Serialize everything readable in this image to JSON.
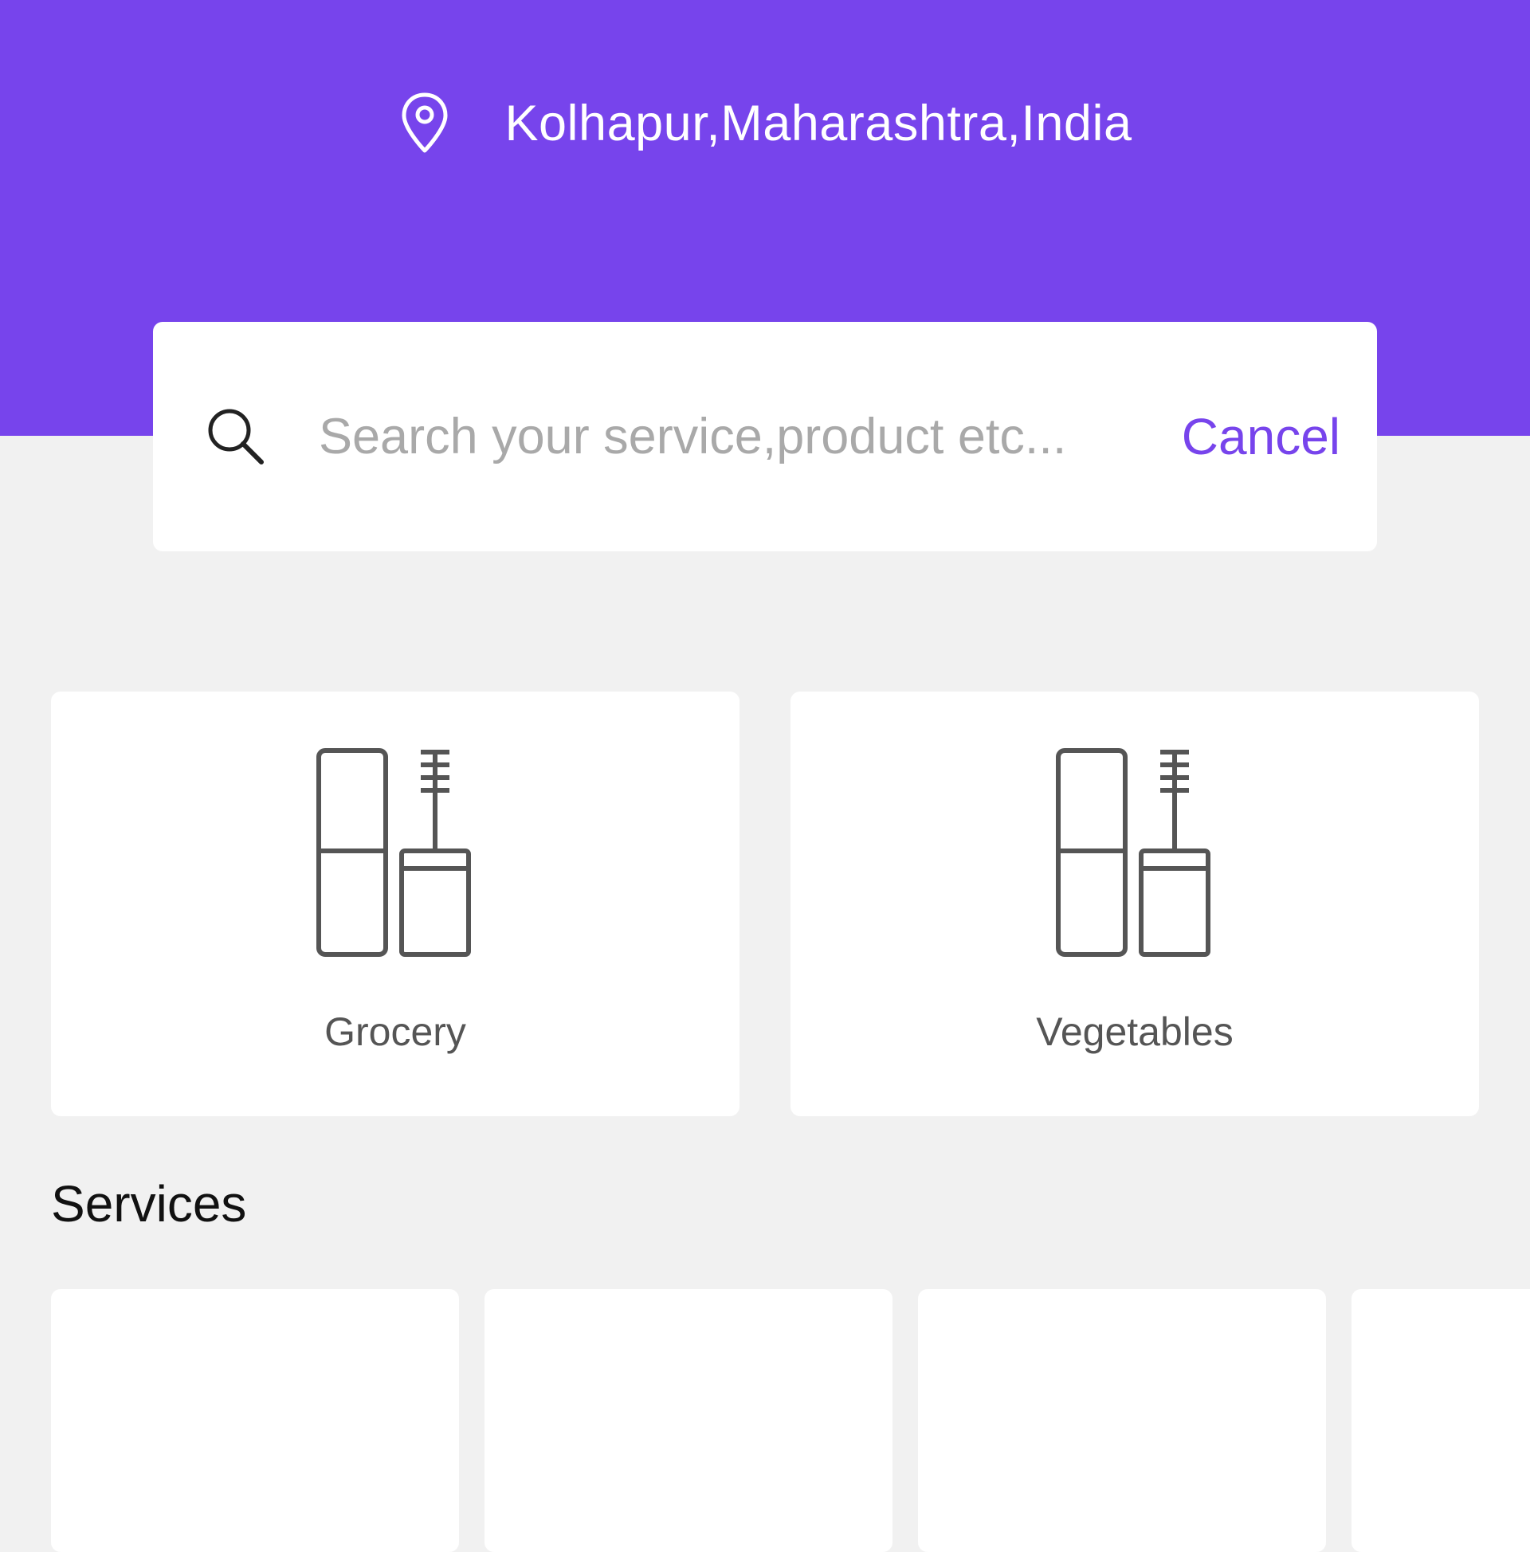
{
  "header": {
    "location": "Kolhapur,Maharashtra,India",
    "location_icon": "map-pin-icon",
    "background_color": "#7744ec"
  },
  "search": {
    "placeholder": "Search your service,product etc...",
    "value": "",
    "icon": "search-icon",
    "cancel_label": "Cancel"
  },
  "categories": [
    {
      "label": "Grocery",
      "icon": "cosmetics-icon"
    },
    {
      "label": "Vegetables",
      "icon": "cosmetics-icon"
    }
  ],
  "services": {
    "title": "Services"
  },
  "colors": {
    "accent": "#7744ec",
    "page_background": "#f1f1f1",
    "card_background": "#ffffff"
  }
}
